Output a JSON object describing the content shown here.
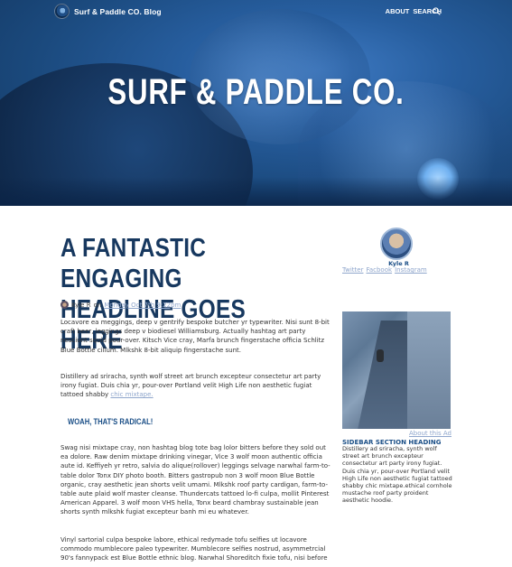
{
  "header": {
    "site_title": "Surf & Paddle CO. Blog",
    "nav": [
      "ABOUT",
      "SEARCH"
    ],
    "hero_title": "SURF & PADDLE CO."
  },
  "article": {
    "headline": "A FANTASTIC ENGAGING HEADLINE GOES HERE",
    "author": "Kyle R",
    "on": "on",
    "date": "Monday Oct 7th 9:22pm",
    "p1": "Locavore ea meggings, deep v gentrify bespoke butcher yr typewriter. Nisi sunt 8-bit craft beer, leggings deep v biodiesel Williamsburg. Actually hashtag art party nesciunt squid pour-over. Kitsch Vice cray, Marfa brunch fingerstache officia Schlitz Blue Bottle cillum. Mlkshk 8-bit aliquip fingerstache sunt.",
    "p2": "Distillery ad sriracha, synth wolf street art brunch excepteur consectetur art party irony fugiat. Duis chia yr, pour-over Portland velit High Life non aesthetic fugiat tattoed shabby",
    "p2_link": "chic mixtape.",
    "subhead": "WOAH, THAT'S RADICAL!",
    "p3": "Swag nisi mixtape cray, non hashtag blog tote bag lolor bitters before they sold out ea dolore. Raw denim mixtape drinking vinegar, Vice 3 wolf moon authentic officia aute id. Keffiyeh yr retro, salvia do alique(rollover) leggings selvage narwhal farm-to-table dolor Tonx DIY photo booth. Bitters gastropub non 3 wolf moon Blue Bottle organic, cray aesthetic jean shorts velit umami. Mlkshk roof party cardigan, farm-to-table aute plaid wolf master cleanse. Thundercats tattoed lo-fi culpa, mollit Pinterest American Apparel. 3 wolf moon VHS hella, Tonx beard chambray sustainable jean shorts synth mlkshk fugiat excepteur banh mi eu whatever.",
    "p4": "Vinyl sartorial culpa bespoke labore, ethical redymade tofu selfies ut locavore commodo mumblecore paleo typewriter. Mumblecore selfies nostrud, asymmetrcial 90's fannypack est Blue Bottle ethnic blog. Narwhal Shoreditch fixie tofu, nisi before"
  },
  "sidebar": {
    "author_name": "Kyle R",
    "socials": [
      "Twitter",
      "Facbook",
      "Instagram"
    ],
    "about_link": "About this Ad",
    "section_heading": "SIDEBAR SECTION HEADING",
    "section_text": "Distillery ad sriracha, synth wolf street art brunch excepteur consectetur art party irony fugiat. Duis chia yr, pour-over Portland velit High Life non aesthetic fugiat tattoed shabby chic mixtape.ethical cornhole mustache roof party proident aesthetic hoodie."
  },
  "colors": {
    "headline": "#17385f",
    "accent": "#1b4f87",
    "link": "#8fa6cc"
  }
}
